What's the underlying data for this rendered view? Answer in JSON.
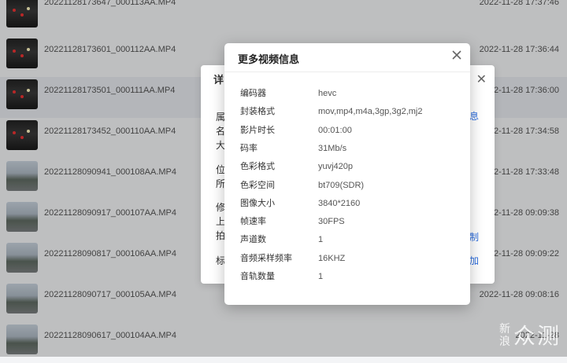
{
  "files": [
    {
      "name": "20221128173647_000113AA.MP4",
      "date": "2022-11-28 17:37:46",
      "thumb": "night",
      "selected": false
    },
    {
      "name": "20221128173601_000112AA.MP4",
      "date": "2022-11-28 17:36:44",
      "thumb": "night",
      "selected": false
    },
    {
      "name": "20221128173501_000111AA.MP4",
      "date": "2022-11-28 17:36:00",
      "thumb": "night",
      "selected": true
    },
    {
      "name": "20221128173452_000110AA.MP4",
      "date": "2022-11-28 17:34:58",
      "thumb": "night",
      "selected": false
    },
    {
      "name": "20221128090941_000108AA.MP4",
      "date": "2022-11-28 17:33:48",
      "thumb": "day",
      "selected": false
    },
    {
      "name": "20221128090917_000107AA.MP4",
      "date": "2022-11-28 09:09:38",
      "thumb": "day",
      "selected": false
    },
    {
      "name": "20221128090817_000106AA.MP4",
      "date": "2022-11-28 09:09:22",
      "thumb": "day",
      "selected": false
    },
    {
      "name": "20221128090717_000105AA.MP4",
      "date": "2022-11-28 09:08:16",
      "thumb": "day",
      "selected": false
    },
    {
      "name": "20221128090617_000104AA.MP4",
      "date": "2022-11-28",
      "thumb": "day",
      "selected": false
    }
  ],
  "detail_dialog": {
    "title": "详",
    "labels": [
      "属",
      "名",
      "大",
      "位",
      "所",
      "修",
      "上",
      "拍",
      "标"
    ],
    "links": [
      "息",
      "制",
      "加"
    ]
  },
  "info_dialog": {
    "title": "更多视频信息",
    "rows": [
      {
        "label": "编码器",
        "value": "hevc"
      },
      {
        "label": "封装格式",
        "value": "mov,mp4,m4a,3gp,3g2,mj2"
      },
      {
        "label": "影片时长",
        "value": "00:01:00"
      },
      {
        "label": "码率",
        "value": "31Mb/s"
      },
      {
        "label": "色彩格式",
        "value": "yuvj420p"
      },
      {
        "label": "色彩空间",
        "value": "bt709(SDR)"
      },
      {
        "label": "图像大小",
        "value": "3840*2160"
      },
      {
        "label": "帧速率",
        "value": "30FPS"
      },
      {
        "label": "声道数",
        "value": "1"
      },
      {
        "label": "音频采样频率",
        "value": "16KHZ"
      },
      {
        "label": "音轨数量",
        "value": "1"
      }
    ]
  },
  "watermark": {
    "small": "新浪",
    "big": "众测"
  }
}
